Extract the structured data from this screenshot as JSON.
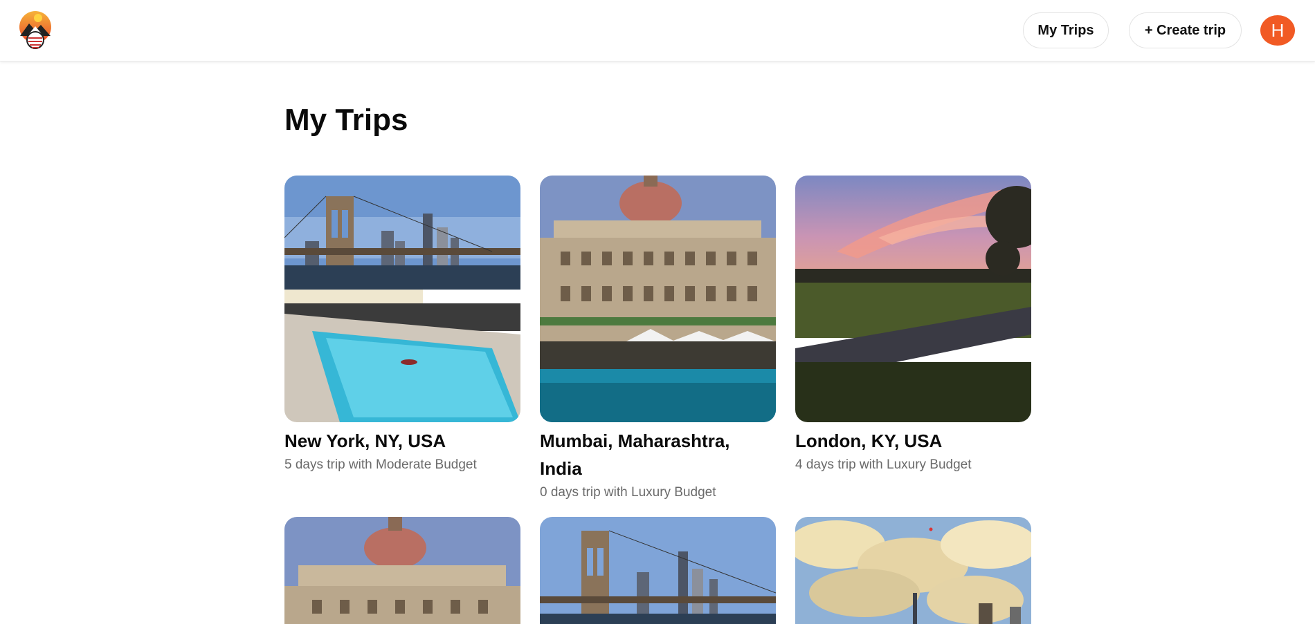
{
  "header": {
    "logo_name": "logo",
    "my_trips_label": "My Trips",
    "create_trip_label": "+ Create trip",
    "avatar_initial": "H",
    "avatar_color": "#f15a24"
  },
  "main": {
    "title": "My Trips",
    "trips": [
      {
        "location": "New York, NY, USA",
        "summary": "5 days trip with Moderate Budget",
        "image": "brooklyn-bridge-pool"
      },
      {
        "location": "Mumbai, Maharashtra, India",
        "summary": "0 days trip with Luxury Budget",
        "image": "taj-palace-pool"
      },
      {
        "location": "London, KY, USA",
        "summary": "4 days trip with Luxury Budget",
        "image": "sunset-park-road"
      },
      {
        "location": "",
        "summary": "",
        "image": "taj-palace"
      },
      {
        "location": "",
        "summary": "",
        "image": "brooklyn-bridge"
      },
      {
        "location": "",
        "summary": "",
        "image": "cloudy-skyline"
      }
    ]
  }
}
